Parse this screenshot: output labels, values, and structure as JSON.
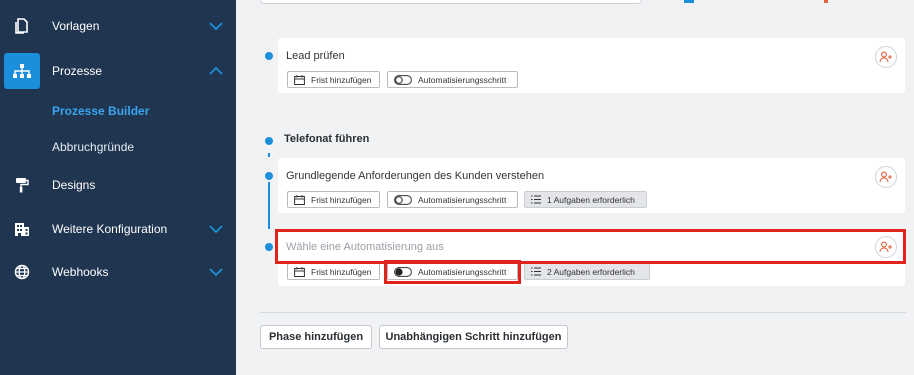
{
  "sidebar": {
    "items": [
      {
        "label": "Vorlagen",
        "icon": "document-icon"
      },
      {
        "label": "Prozesse",
        "icon": "sitemap-icon"
      },
      {
        "label": "Designs",
        "icon": "paint-roller-icon"
      },
      {
        "label": "Weitere Konfiguration",
        "icon": "building-icon"
      },
      {
        "label": "Webhooks",
        "icon": "globe-icon"
      }
    ],
    "sub_items": [
      {
        "label": "Prozesse Builder"
      },
      {
        "label": "Abbruchgründe"
      }
    ]
  },
  "steps": [
    {
      "title": "Lead prüfen",
      "chips": [
        "Frist hinzufügen",
        "Automatisierungsschritt"
      ]
    },
    {
      "title": "Grundlegende Anforderungen des Kunden verstehen",
      "chips": [
        "Frist hinzufügen",
        "Automatisierungsschritt",
        "1 Aufgaben erforderlich"
      ]
    },
    {
      "placeholder": "Wähle eine Automatisierung aus",
      "chips": [
        "Frist hinzufügen",
        "Automatisierungsschritt",
        "2 Aufgaben erforderlich"
      ]
    }
  ],
  "phase": {
    "title": "Telefonat führen"
  },
  "buttons": {
    "add_phase": "Phase hinzufügen",
    "add_independent_step": "Unabhängigen Schritt hinzufügen"
  },
  "colors": {
    "sidebar_bg": "#1f3550",
    "accent": "#1b8fdc",
    "highlight": "#e0231c",
    "person_icon": "#e0623a"
  }
}
